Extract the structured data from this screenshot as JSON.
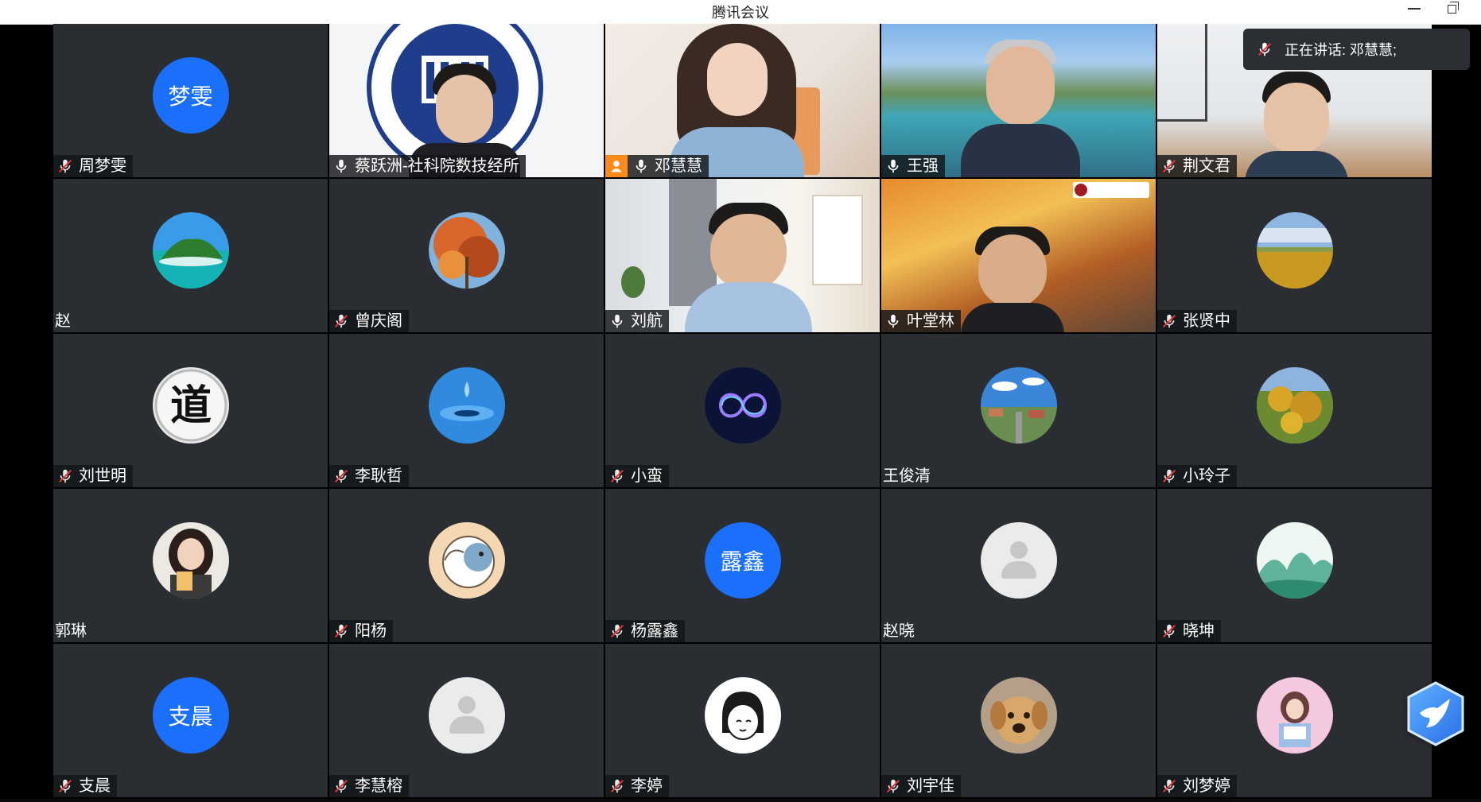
{
  "app": {
    "title": "腾讯会议"
  },
  "speaker": {
    "label": "正在讲话: 邓慧慧;"
  },
  "colors": {
    "avatar_blue": "#1a6ffb",
    "tile_bg": "#2a2d31",
    "host_orange": "#ff8a1d"
  },
  "tiles": [
    {
      "name": "周梦雯",
      "mic": "muted",
      "avatar": "letter",
      "avatar_text": "梦雯"
    },
    {
      "name": "蔡跃洲-社科院数技经所",
      "mic": "on",
      "avatar": "video"
    },
    {
      "name": "邓慧慧",
      "mic": "on",
      "avatar": "video",
      "host": true
    },
    {
      "name": "王强",
      "mic": "on",
      "avatar": "video"
    },
    {
      "name": "荆文君",
      "mic": "muted",
      "avatar": "video"
    },
    {
      "name": "赵",
      "mic": "none",
      "avatar": "image",
      "icon": "island-avatar-icon"
    },
    {
      "name": "曾庆阁",
      "mic": "muted",
      "avatar": "image",
      "icon": "autumn-tree-avatar-icon"
    },
    {
      "name": "刘航",
      "mic": "on",
      "avatar": "video"
    },
    {
      "name": "叶堂林",
      "mic": "on",
      "avatar": "video"
    },
    {
      "name": "张贤中",
      "mic": "muted",
      "avatar": "image",
      "icon": "grassland-avatar-icon"
    },
    {
      "name": "刘世明",
      "mic": "muted",
      "avatar": "image",
      "icon": "calligraphy-dao-avatar-icon",
      "avatar_text": "道"
    },
    {
      "name": "李耿哲",
      "mic": "muted",
      "avatar": "image",
      "icon": "water-drop-avatar-icon"
    },
    {
      "name": "小蛮",
      "mic": "muted",
      "avatar": "image",
      "icon": "infinity-avatar-icon"
    },
    {
      "name": "王俊清",
      "mic": "none",
      "avatar": "image",
      "icon": "town-avatar-icon"
    },
    {
      "name": "小玲子",
      "mic": "muted",
      "avatar": "image",
      "icon": "sunflower-avatar-icon"
    },
    {
      "name": "郭琳",
      "mic": "none",
      "avatar": "image",
      "icon": "girl-photo-avatar-icon"
    },
    {
      "name": "阳杨",
      "mic": "muted",
      "avatar": "image",
      "icon": "cartoon-elephant-avatar-icon"
    },
    {
      "name": "杨露鑫",
      "mic": "muted",
      "avatar": "letter",
      "avatar_text": "露鑫"
    },
    {
      "name": "赵晓",
      "mic": "none",
      "avatar": "default"
    },
    {
      "name": "晓坤",
      "mic": "muted",
      "avatar": "image",
      "icon": "ink-landscape-avatar-icon"
    },
    {
      "name": "支晨",
      "mic": "muted",
      "avatar": "letter",
      "avatar_text": "支晨"
    },
    {
      "name": "李慧榕",
      "mic": "muted",
      "avatar": "default"
    },
    {
      "name": "李婷",
      "mic": "muted",
      "avatar": "image",
      "icon": "cartoon-girl-avatar-icon"
    },
    {
      "name": "刘宇佳",
      "mic": "muted",
      "avatar": "image",
      "icon": "puppy-avatar-icon"
    },
    {
      "name": "刘梦婷",
      "mic": "muted",
      "avatar": "image",
      "icon": "illustrated-girl-avatar-icon"
    }
  ]
}
